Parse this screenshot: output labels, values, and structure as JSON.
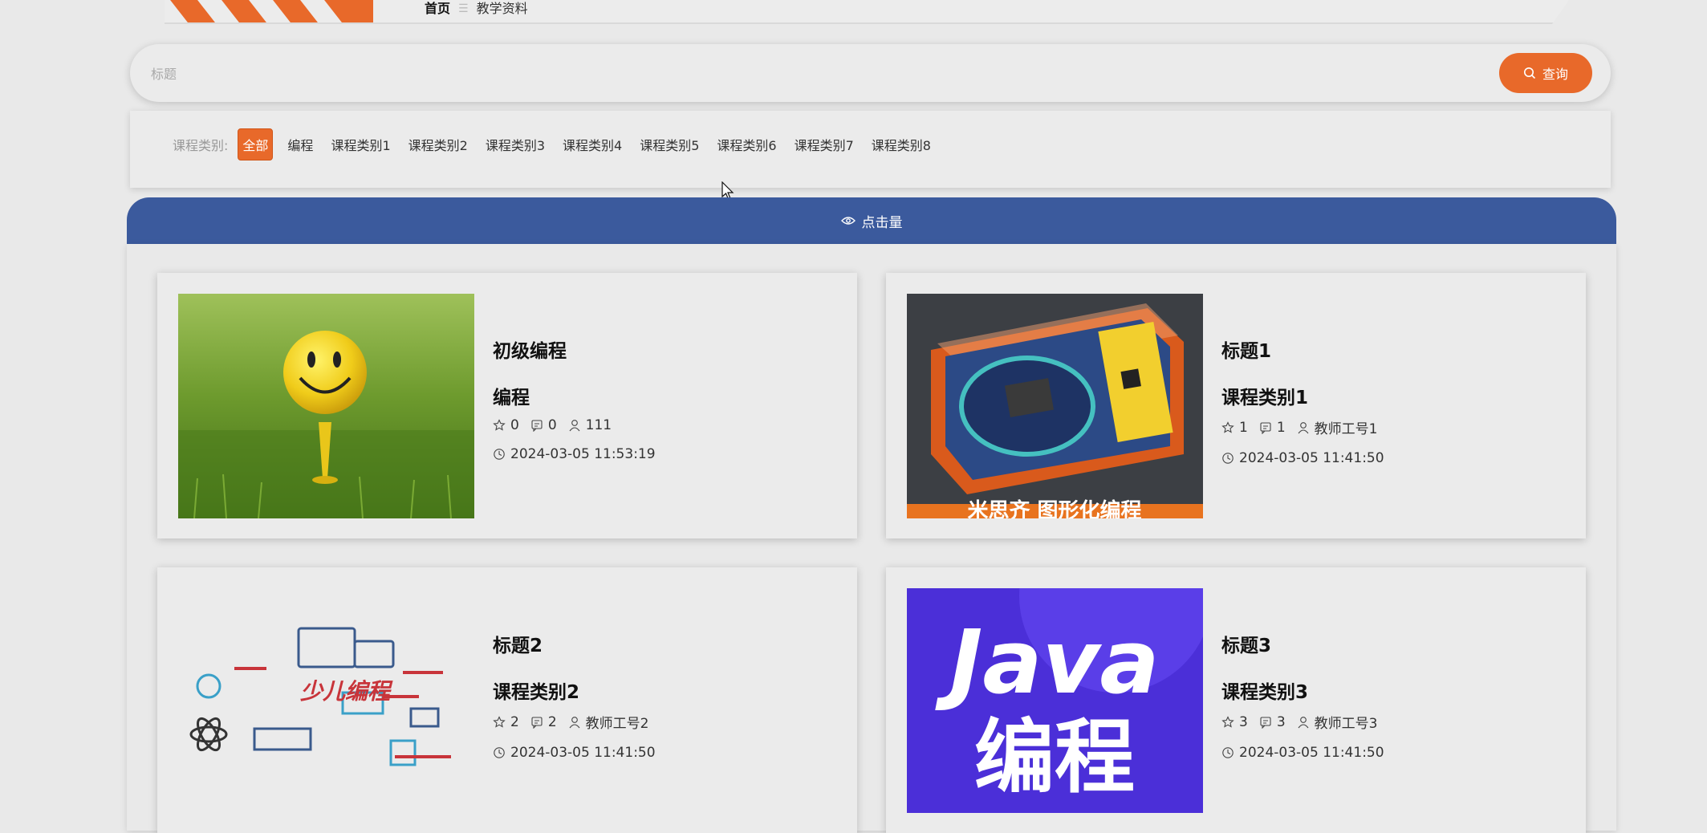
{
  "breadcrumb": {
    "home": "首页",
    "separator": "☰",
    "current": "教学资料"
  },
  "search": {
    "placeholder": "标题",
    "button_label": "查询"
  },
  "filter": {
    "label": "课程类别:",
    "items": [
      "全部",
      "编程",
      "课程类别1",
      "课程类别2",
      "课程类别3",
      "课程类别4",
      "课程类别5",
      "课程类别6",
      "课程类别7",
      "课程类别8"
    ],
    "active": "全部"
  },
  "sort": {
    "label": "点击量"
  },
  "cards": [
    {
      "title": "初级编程",
      "category": "编程",
      "favorites": "0",
      "comments": "0",
      "author": "111",
      "time": "2024-03-05 11:53:19",
      "image": "smiley-golf-ball"
    },
    {
      "title": "标题1",
      "category": "课程类别1",
      "favorites": "1",
      "comments": "1",
      "author": "教师工号1",
      "time": "2024-03-05 11:41:50",
      "image": "electronics-kit-box",
      "image_caption": "米思齐 图形化编程"
    },
    {
      "title": "标题2",
      "category": "课程类别2",
      "favorites": "2",
      "comments": "2",
      "author": "教师工号2",
      "time": "2024-03-05 11:41:50",
      "image": "kids-coding-illustration",
      "image_caption": "少儿编程"
    },
    {
      "title": "标题3",
      "category": "课程类别3",
      "favorites": "3",
      "comments": "3",
      "author": "教师工号3",
      "time": "2024-03-05 11:41:50",
      "image": "java-programming-cover",
      "image_caption_1": "Java",
      "image_caption_2": "编程"
    }
  ],
  "colors": {
    "accent": "#e8692a",
    "sort_bar": "#3b5a9d",
    "page_bg": "#e9e9e9"
  }
}
